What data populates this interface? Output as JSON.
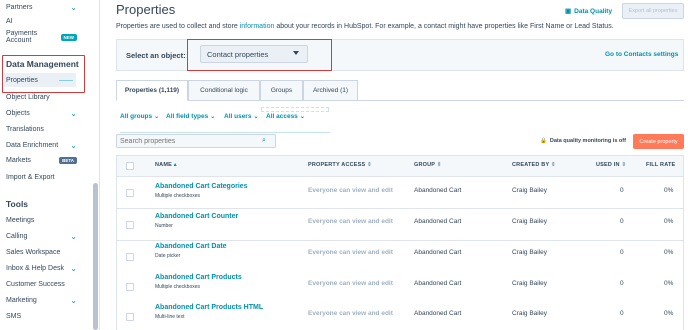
{
  "sidebar": {
    "items_top": [
      {
        "label": "Partners",
        "chevron": true
      },
      {
        "label": "AI",
        "chevron": false
      },
      {
        "label": "Payments Account",
        "badge": "NEW"
      }
    ],
    "section_data_management": "Data Management",
    "data_management_items": [
      {
        "label": "Properties",
        "active": true
      },
      {
        "label": "Object Library"
      },
      {
        "label": "Objects",
        "chevron": true
      },
      {
        "label": "Translations"
      },
      {
        "label": "Data Enrichment",
        "chevron": true
      },
      {
        "label": "Markets",
        "badge": "BETA"
      },
      {
        "label": "Import & Export"
      }
    ],
    "section_tools": "Tools",
    "tools_items": [
      {
        "label": "Meetings"
      },
      {
        "label": "Calling",
        "chevron": true
      },
      {
        "label": "Sales Workspace"
      },
      {
        "label": "Inbox & Help Desk",
        "chevron": true
      },
      {
        "label": "Customer Success"
      },
      {
        "label": "Marketing",
        "chevron": true
      },
      {
        "label": "SMS"
      }
    ]
  },
  "header": {
    "title": "Properties",
    "data_quality_label": "Data Quality",
    "export_label": "Export all properties",
    "description_before": "Properties are used to collect and store ",
    "description_link": "information",
    "description_after": " about your records in HubSpot. For example, a contact might have properties like First Name or Lead Status."
  },
  "object_selector": {
    "label": "Select an object:",
    "value": "Contact properties",
    "goto_label": "Go to Contacts settings"
  },
  "tabs": [
    {
      "label": "Properties (1,119)",
      "active": true
    },
    {
      "label": "Conditional logic"
    },
    {
      "label": "Groups"
    },
    {
      "label": "Archived (1)"
    }
  ],
  "filters": [
    "All groups",
    "All field types",
    "All users",
    "All access"
  ],
  "search": {
    "placeholder": "Search properties"
  },
  "data_quality_monitoring": "Data quality monitoring is off",
  "create_property": "Create property",
  "table": {
    "columns": [
      "NAME",
      "PROPERTY ACCESS",
      "GROUP",
      "CREATED BY",
      "USED IN",
      "FILL RATE"
    ],
    "rows": [
      {
        "name": "Abandoned Cart Categories",
        "type": "Multiple checkboxes",
        "access": "Everyone can view and edit",
        "group": "Abandoned Cart",
        "created_by": "Craig Bailey",
        "used_in": "0",
        "fill_rate": "0%"
      },
      {
        "name": "Abandoned Cart Counter",
        "type": "Number",
        "access": "Everyone can view and edit",
        "group": "Abandoned Cart",
        "created_by": "Craig Bailey",
        "used_in": "0",
        "fill_rate": "0%"
      },
      {
        "name": "Abandoned Cart Date",
        "type": "Date picker",
        "access": "Everyone can view and edit",
        "group": "Abandoned Cart",
        "created_by": "Craig Bailey",
        "used_in": "0",
        "fill_rate": "0%"
      },
      {
        "name": "Abandoned Cart Products",
        "type": "Multiple checkboxes",
        "access": "Everyone can view and edit",
        "group": "Abandoned Cart",
        "created_by": "Craig Bailey",
        "used_in": "0",
        "fill_rate": "0%"
      },
      {
        "name": "Abandoned Cart Products HTML",
        "type": "Multi-line text",
        "access": "Everyone can view and edit",
        "group": "Abandoned Cart",
        "created_by": "Craig Bailey",
        "used_in": "0",
        "fill_rate": "0%"
      }
    ]
  },
  "colors": {
    "accent": "#0091ae",
    "primary_button": "#ff7a59",
    "highlight_border": "#d13b3b",
    "text": "#33475b"
  }
}
